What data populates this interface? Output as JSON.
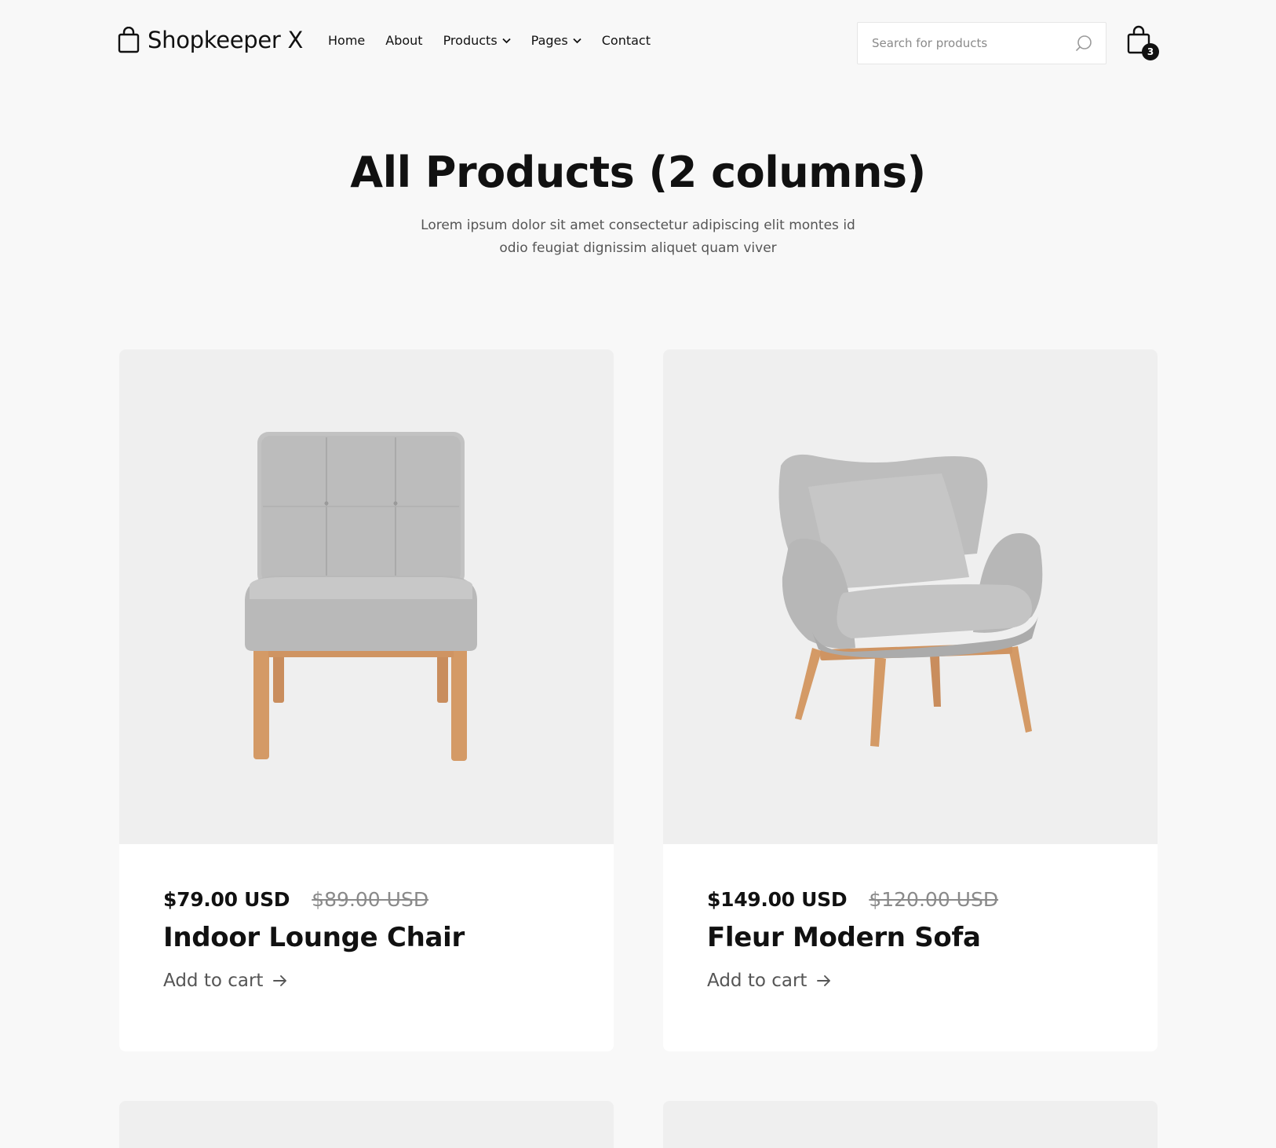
{
  "header": {
    "brand": "Shopkeeper X",
    "nav": [
      {
        "label": "Home",
        "dropdown": false
      },
      {
        "label": "About",
        "dropdown": false
      },
      {
        "label": "Products",
        "dropdown": true
      },
      {
        "label": "Pages",
        "dropdown": true
      },
      {
        "label": "Contact",
        "dropdown": false
      }
    ],
    "search": {
      "placeholder": "Search for products",
      "value": ""
    },
    "cart_count": "3"
  },
  "hero": {
    "title": "All Products (2 columns)",
    "subtitle": "Lorem ipsum dolor sit amet consectetur adipiscing elit montes id odio feugiat dignissim aliquet quam viver"
  },
  "products": [
    {
      "name": "Indoor Lounge Chair",
      "price": "$79.00 USD",
      "old_price": "$89.00 USD",
      "cta": "Add to cart"
    },
    {
      "name": "Fleur Modern Sofa",
      "price": "$149.00 USD",
      "old_price": "$120.00 USD",
      "cta": "Add to cart"
    }
  ],
  "colors": {
    "page_bg": "#f8f8f8",
    "image_bg": "#efefef",
    "text": "#111111",
    "muted": "#8a8a8a",
    "fabric": "#bdbdbd",
    "wood": "#d49a66"
  }
}
